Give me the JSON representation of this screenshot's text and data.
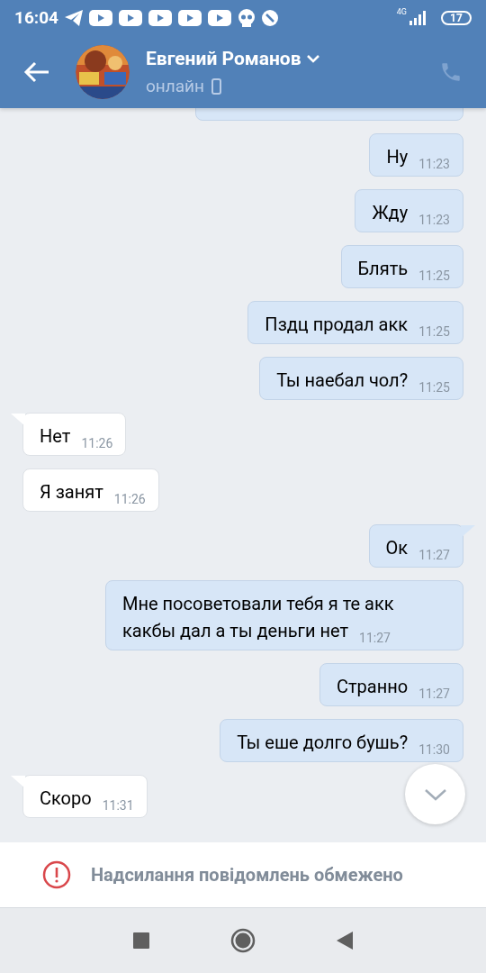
{
  "status_bar": {
    "time": "16:04",
    "network": "4G",
    "battery": "17"
  },
  "header": {
    "name": "Евгений Романов",
    "status": "онлайн"
  },
  "messages": [
    {
      "outgoing": true,
      "partial": true,
      "tail": false
    },
    {
      "outgoing": true,
      "text": "Ну",
      "time": "11:23",
      "tail": false
    },
    {
      "outgoing": true,
      "text": "Жду",
      "time": "11:23",
      "tail": false
    },
    {
      "outgoing": true,
      "text": "Блять",
      "time": "11:25",
      "tail": false
    },
    {
      "outgoing": true,
      "text": "Пздц продал акк",
      "time": "11:25",
      "tail": false
    },
    {
      "outgoing": true,
      "text": "Ты наебал чол?",
      "time": "11:25",
      "tail": false
    },
    {
      "outgoing": false,
      "text": "Нет",
      "time": "11:26",
      "tail": true
    },
    {
      "outgoing": false,
      "text": "Я занят",
      "time": "11:26",
      "tail": false
    },
    {
      "outgoing": true,
      "text": "Ок",
      "time": "11:27",
      "tail": true
    },
    {
      "outgoing": true,
      "text": "Мне посоветовали тебя я те акк какбы дал а ты деньги нет",
      "time": "11:27",
      "tail": false
    },
    {
      "outgoing": true,
      "text": "Странно",
      "time": "11:27",
      "tail": false
    },
    {
      "outgoing": true,
      "text": "Ты еше долго бушь?",
      "time": "11:30",
      "tail": false
    },
    {
      "outgoing": false,
      "text": "Скоро",
      "time": "11:31",
      "tail": true
    }
  ],
  "banner": {
    "text": "Надсилання повідомлень обмежено"
  }
}
